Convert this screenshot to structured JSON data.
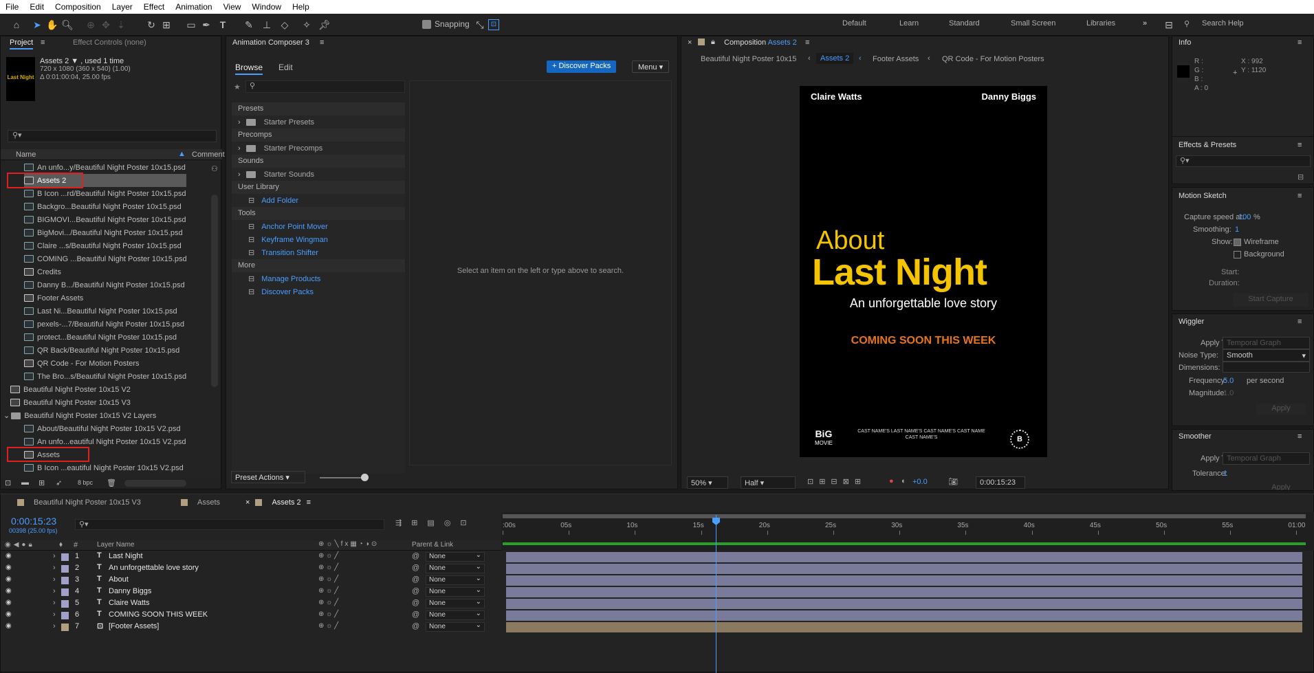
{
  "menu": [
    "File",
    "Edit",
    "Composition",
    "Layer",
    "Effect",
    "Animation",
    "View",
    "Window",
    "Help"
  ],
  "toolbar": {
    "snapping": "Snapping",
    "workspaces": [
      "Default",
      "Learn",
      "Standard",
      "Small Screen",
      "Libraries"
    ],
    "search_help": "Search Help"
  },
  "project": {
    "tab": "Project",
    "effect_controls": "Effect Controls (none)",
    "item_name": "Assets 2 ▼ , used 1 time",
    "item_dims": "720 x 1080  (360 x 540) (1.00)",
    "item_dur": "Δ 0:01:00:04, 25.00 fps",
    "col_name": "Name",
    "col_comment": "Comment",
    "bpc": "8 bpc",
    "items": [
      {
        "t": "An unfo...y/Beautiful Night Poster 10x15.psd",
        "k": "file",
        "l": 1
      },
      {
        "t": "Assets 2",
        "k": "comp",
        "l": 1
      },
      {
        "t": "B Icon ...rd/Beautiful Night Poster 10x15.psd",
        "k": "file",
        "l": 1
      },
      {
        "t": "Backgro...Beautiful Night Poster 10x15.psd",
        "k": "file",
        "l": 1
      },
      {
        "t": "BIGMOVI...Beautiful Night Poster 10x15.psd",
        "k": "file",
        "l": 1
      },
      {
        "t": "BigMovi.../Beautiful Night Poster 10x15.psd",
        "k": "file",
        "l": 1
      },
      {
        "t": "Claire ...s/Beautiful Night Poster 10x15.psd",
        "k": "file",
        "l": 1
      },
      {
        "t": "COMING ...Beautiful Night Poster 10x15.psd",
        "k": "file",
        "l": 1
      },
      {
        "t": "Credits",
        "k": "comp",
        "l": 1
      },
      {
        "t": "Danny B.../Beautiful Night Poster 10x15.psd",
        "k": "file",
        "l": 1
      },
      {
        "t": "Footer Assets",
        "k": "comp",
        "l": 1
      },
      {
        "t": "Last Ni...Beautiful Night Poster 10x15.psd",
        "k": "file",
        "l": 1
      },
      {
        "t": "pexels-...7/Beautiful Night Poster 10x15.psd",
        "k": "file",
        "l": 1
      },
      {
        "t": "protect...Beautiful Night Poster 10x15.psd",
        "k": "file",
        "l": 1
      },
      {
        "t": "QR Back/Beautiful Night Poster 10x15.psd",
        "k": "file",
        "l": 1
      },
      {
        "t": "QR Code - For Motion Posters",
        "k": "comp",
        "l": 1
      },
      {
        "t": "The Bro...s/Beautiful Night Poster 10x15.psd",
        "k": "file",
        "l": 1
      },
      {
        "t": "Beautiful Night Poster 10x15 V2",
        "k": "comp",
        "l": 0
      },
      {
        "t": "Beautiful Night Poster 10x15 V3",
        "k": "comp",
        "l": 0
      },
      {
        "t": "Beautiful Night Poster 10x15 V2 Layers",
        "k": "folder",
        "l": 0
      },
      {
        "t": "About/Beautiful Night Poster 10x15 V2.psd",
        "k": "file",
        "l": 1
      },
      {
        "t": "An unfo...eautiful Night Poster 10x15 V2.psd",
        "k": "file",
        "l": 1
      },
      {
        "t": "Assets",
        "k": "comp",
        "l": 1
      },
      {
        "t": "B Icon ...eautiful Night Poster 10x15 V2.psd",
        "k": "file",
        "l": 1
      }
    ]
  },
  "composer": {
    "tab": "Animation Composer 3",
    "browse": "Browse",
    "edit": "Edit",
    "discover": "+ Discover Packs",
    "menu": "Menu",
    "hint": "Select an item on the left or type above to search.",
    "preset_actions": "Preset Actions",
    "sections": [
      {
        "h": "Presets",
        "items": [
          {
            "t": "Starter Presets",
            "k": "folder"
          }
        ]
      },
      {
        "h": "Precomps",
        "items": [
          {
            "t": "Starter Precomps",
            "k": "folder"
          }
        ]
      },
      {
        "h": "Sounds",
        "items": [
          {
            "t": "Starter Sounds",
            "k": "folder"
          }
        ]
      },
      {
        "h": "User Library",
        "items": [
          {
            "t": "Add Folder",
            "k": "link"
          }
        ]
      },
      {
        "h": "Tools",
        "items": [
          {
            "t": "Anchor Point Mover",
            "k": "link"
          },
          {
            "t": "Keyframe Wingman",
            "k": "link"
          },
          {
            "t": "Transition Shifter",
            "k": "link"
          }
        ]
      },
      {
        "h": "More",
        "items": [
          {
            "t": "Manage Products",
            "k": "link"
          },
          {
            "t": "Discover Packs",
            "k": "link"
          }
        ]
      }
    ]
  },
  "comp": {
    "tab_prefix": "Composition",
    "tab_name": "Assets 2",
    "breadcrumbs": [
      "Beautiful Night Poster 10x15",
      "Assets 2",
      "Footer Assets",
      "QR Code - For Motion Posters"
    ],
    "zoom": "50%",
    "res": "Half",
    "exposure": "+0.0",
    "time": "0:00:15:23",
    "poster": {
      "name_left": "Claire Watts",
      "name_right": "Danny Biggs",
      "about": "About",
      "title": "Last Night",
      "tagline": "An unforgettable love story",
      "coming": "COMING SOON THIS WEEK",
      "logo_l1": "BiG",
      "logo_l2": "MOVIE",
      "billing": "CAST NAME'S LAST NAME'S CAST NAME'S CAST NAME CAST NAME'S"
    }
  },
  "info": {
    "title": "Info",
    "r": "R :",
    "g": "G :",
    "b": "B :",
    "a": "A :  0",
    "x": "X : 992",
    "y": "Y : 1120"
  },
  "effects": {
    "title": "Effects & Presets"
  },
  "motion": {
    "title": "Motion Sketch",
    "speed_label": "Capture speed at:",
    "speed": "100",
    "pct": "%",
    "smooth_label": "Smoothing:",
    "smooth": "1",
    "show": "Show:",
    "wireframe": "Wireframe",
    "background": "Background",
    "start": "Start:",
    "duration": "Duration:",
    "capture": "Start Capture"
  },
  "wiggler": {
    "title": "Wiggler",
    "apply": "Apply To:",
    "apply_val": "Temporal Graph",
    "noise": "Noise Type:",
    "noise_val": "Smooth",
    "dims": "Dimensions:",
    "freq": "Frequency:",
    "freq_val": "5.0",
    "per": "per second",
    "mag": "Magnitude:",
    "mag_val": "1.0",
    "btn": "Apply"
  },
  "smoother": {
    "title": "Smoother",
    "apply": "Apply To:",
    "apply_val": "Temporal Graph",
    "tol": "Tolerance:",
    "tol_val": "1",
    "btn": "Apply"
  },
  "timeline": {
    "tabs": [
      "Beautiful Night Poster 10x15 V3",
      "Assets",
      "Assets 2"
    ],
    "time": "0:00:15:23",
    "frames": "00398 (25.00 fps)",
    "col_layer": "Layer Name",
    "col_parent": "Parent & Link",
    "ticks": [
      ":00s",
      "05s",
      "10s",
      "15s",
      "20s",
      "25s",
      "30s",
      "35s",
      "40s",
      "45s",
      "50s",
      "55s",
      "01:00"
    ],
    "layers": [
      {
        "n": "1",
        "type": "T",
        "name": "Last Night",
        "parent": "None",
        "color": "#a0a0c8"
      },
      {
        "n": "2",
        "type": "T",
        "name": "An unforgettable love story",
        "parent": "None",
        "color": "#a0a0c8"
      },
      {
        "n": "3",
        "type": "T",
        "name": "About",
        "parent": "None",
        "color": "#a0a0c8"
      },
      {
        "n": "4",
        "type": "T",
        "name": "Danny Biggs",
        "parent": "None",
        "color": "#a0a0c8"
      },
      {
        "n": "5",
        "type": "T",
        "name": "Claire Watts",
        "parent": "None",
        "color": "#a0a0c8"
      },
      {
        "n": "6",
        "type": "T",
        "name": "COMING SOON THIS WEEK",
        "parent": "None",
        "color": "#a0a0c8"
      },
      {
        "n": "7",
        "type": "C",
        "name": "[Footer Assets]",
        "parent": "None",
        "color": "#b0a080"
      }
    ]
  }
}
